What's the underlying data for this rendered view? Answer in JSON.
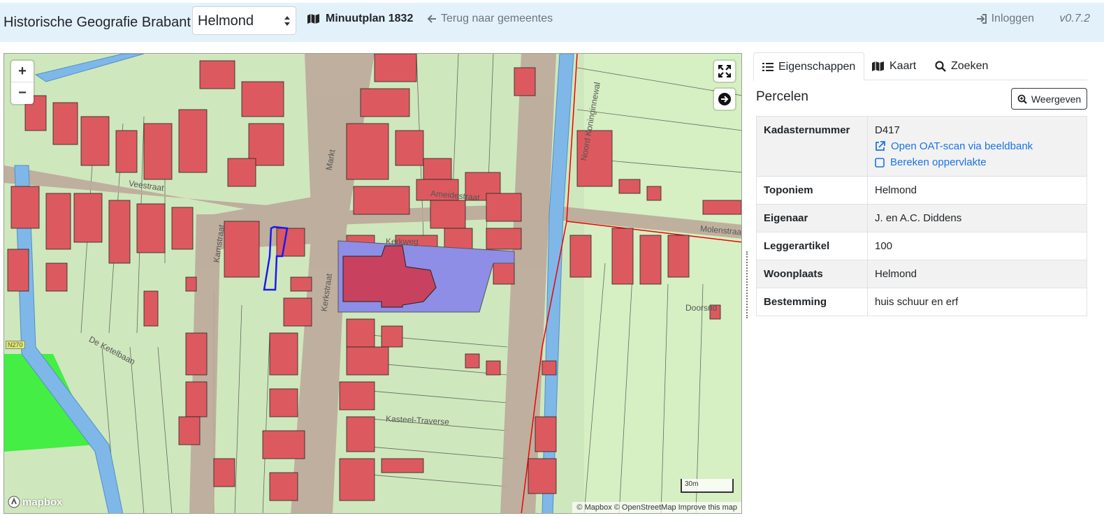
{
  "header": {
    "brand": "Historische Geografie Brabant",
    "municipality": "Helmond",
    "layer_title": "Minuutplan 1832",
    "back_link": "Terug naar gemeentes",
    "login": "Inloggen",
    "version": "v0.7.2"
  },
  "map": {
    "zoom_in": "+",
    "zoom_out": "−",
    "scale_label": "30m",
    "logo": "mapbox",
    "attribution": "© Mapbox © OpenStreetMap Improve this map",
    "street_labels": [
      "Veestraat",
      "Markt",
      "Ameidestraat",
      "Molenstraat",
      "Kerkweg",
      "Kerkstraat",
      "Kamstraat",
      "Kasteel-Traverse",
      "De Ketelbaan",
      "Doorsnd",
      "Noord Koninginnewal",
      "N270"
    ],
    "colors": {
      "building": "#dc5a5f",
      "parcel": "#c8e6b0",
      "road": "#bca89a",
      "water": "#7fb8e8",
      "church": "#8e8ee6",
      "selected": "#1a1aee"
    }
  },
  "panel": {
    "tabs": [
      {
        "label": "Eigenschappen",
        "icon": "list-icon",
        "active": true
      },
      {
        "label": "Kaart",
        "icon": "map-icon",
        "active": false
      },
      {
        "label": "Zoeken",
        "icon": "search-icon",
        "active": false
      }
    ],
    "title": "Percelen",
    "show_button": "Weergeven",
    "rows": [
      {
        "key": "Kadasternummer",
        "value": "D417"
      },
      {
        "key": "Toponiem",
        "value": "Helmond"
      },
      {
        "key": "Eigenaar",
        "value": "J. en A.C. Diddens"
      },
      {
        "key": "Leggerartikel",
        "value": "100"
      },
      {
        "key": "Woonplaats",
        "value": "Helmond"
      },
      {
        "key": "Bestemming",
        "value": "huis schuur en erf"
      }
    ],
    "links": {
      "open_scan": "Open OAT-scan via beeldbank",
      "compute_area": "Bereken oppervlakte"
    }
  }
}
